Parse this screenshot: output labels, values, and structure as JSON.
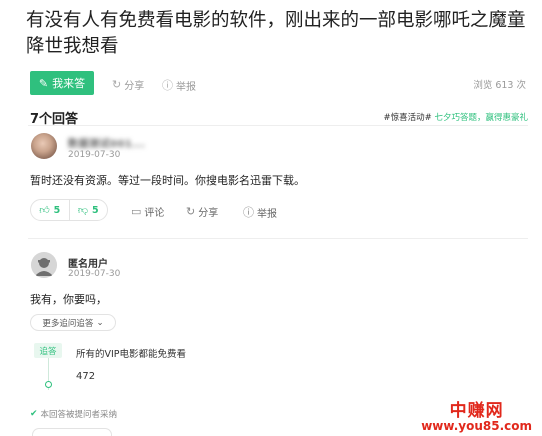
{
  "question": {
    "title": "有没有人有免费看电影的软件，刚出来的一部电影哪吒之魔童降世我想看",
    "answer_button": "我来答",
    "share": "分享",
    "report": "举报",
    "views": "浏览 613 次"
  },
  "answers_count": "7个回答",
  "promo": {
    "prefix": "#惊喜活动#",
    "link": "七夕巧答题，赢得惠豪礼"
  },
  "answer1": {
    "user": "数据测试001...",
    "date": "2019-07-30",
    "text": "暂时还没有资源。等过一段时间。你搜电影名迅雷下载。",
    "upvotes": "5",
    "downvotes": "5",
    "comment": "评论",
    "share": "分享",
    "report": "举报"
  },
  "answer2": {
    "user": "匿名用户",
    "date": "2019-07-30",
    "text": "我有，你要吗，",
    "more_button": "更多追问追答",
    "reply_tag": "追答",
    "followup_question": "所有的VIP电影都能免费看",
    "followup_answer": "472",
    "adopted": "本回答被提问者采纳"
  },
  "watermark": {
    "line1": "中赚网",
    "line2": "www.you85.com"
  }
}
